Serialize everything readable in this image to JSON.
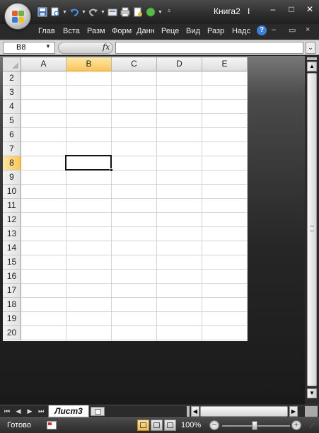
{
  "window": {
    "title": "Книга2",
    "app_name": "I",
    "controls": {
      "minimize": "–",
      "maximize": "□",
      "close": "✕"
    }
  },
  "ribbon": {
    "tabs": [
      "Глав",
      "Вста",
      "Разм",
      "Форм",
      "Данн",
      "Реце",
      "Вид",
      "Разр",
      "Надс"
    ],
    "help_label": "?",
    "controls": {
      "minimize": "–",
      "restore": "▭",
      "close": "×"
    }
  },
  "formula_bar": {
    "name_box": "B8",
    "fx_label": "fx",
    "value": ""
  },
  "sheet": {
    "columns": [
      "A",
      "B",
      "C",
      "D",
      "E"
    ],
    "rows": [
      "2",
      "3",
      "4",
      "5",
      "6",
      "7",
      "8",
      "9",
      "10",
      "11",
      "12",
      "13",
      "14",
      "15",
      "16",
      "17",
      "18",
      "19",
      "20"
    ],
    "selected_column": "B",
    "selected_row": "8"
  },
  "sheet_tabs": {
    "active": "Лист3"
  },
  "status_bar": {
    "status": "Готово",
    "zoom": "100%",
    "zoom_minus": "−",
    "zoom_plus": "+"
  }
}
